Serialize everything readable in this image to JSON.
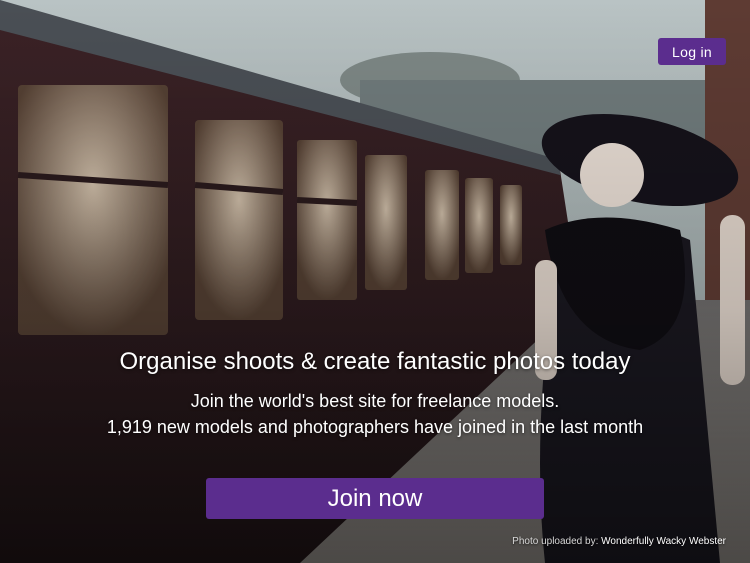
{
  "header": {
    "login_label": "Log in"
  },
  "hero": {
    "headline": "Organise shoots & create fantastic photos today",
    "subline1": "Join the world's best site for freelance models.",
    "subline2": "1,919 new models and photographers have joined in the last month",
    "cta_label": "Join now"
  },
  "credit": {
    "prefix": "Photo uploaded by:",
    "author": "Wonderfully Wacky Webster"
  },
  "colors": {
    "accent": "#5b2d8e"
  }
}
